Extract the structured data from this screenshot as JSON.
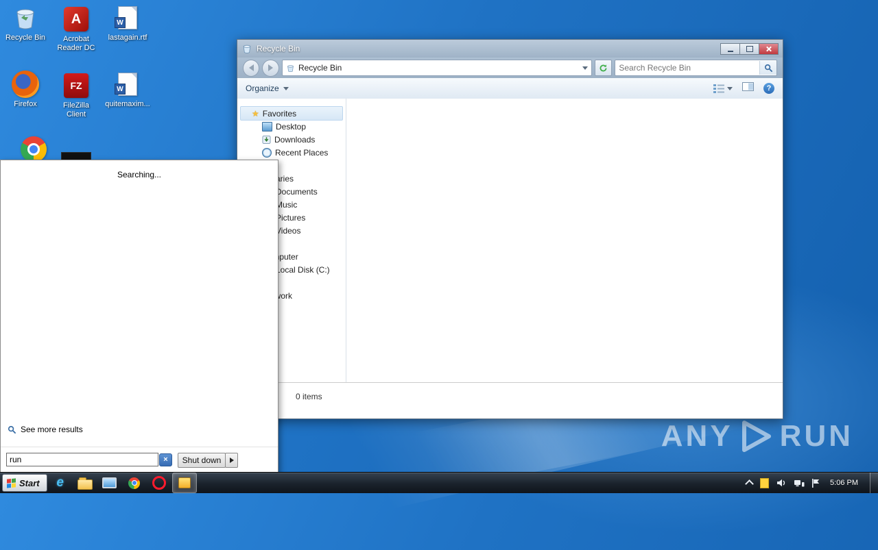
{
  "glyphs": {
    "word": "W",
    "filezilla": "FZ",
    "acrobat": "A",
    "ie": "e",
    "help": "?",
    "close_x": "×"
  },
  "desktop": {
    "icons": [
      {
        "label": "Recycle Bin"
      },
      {
        "label": "Acrobat Reader DC"
      },
      {
        "label": "lastagain.rtf"
      },
      {
        "label": "Firefox"
      },
      {
        "label": "FileZilla Client"
      },
      {
        "label": "quitemaxim..."
      }
    ],
    "watermark": {
      "left": "ANY",
      "right": "RUN"
    }
  },
  "explorer": {
    "title": "Recycle Bin",
    "address": "Recycle Bin",
    "search_placeholder": "Search Recycle Bin",
    "organize_label": "Organize",
    "status": "0 items",
    "nav": {
      "favorites_label": "Favorites",
      "favorites_items": [
        {
          "label": "Desktop"
        },
        {
          "label": "Downloads"
        },
        {
          "label": "Recent Places"
        }
      ],
      "libraries_label": "Libraries",
      "libraries_items": [
        {
          "label": "Documents"
        },
        {
          "label": "Music"
        },
        {
          "label": "Pictures"
        },
        {
          "label": "Videos"
        }
      ],
      "computer_label": "Computer",
      "computer_items": [
        {
          "label": "Local Disk (C:)"
        }
      ],
      "network_label": "Network"
    }
  },
  "start_menu": {
    "searching": "Searching...",
    "see_more": "See more results",
    "search_value": "run",
    "shutdown_label": "Shut down"
  },
  "taskbar": {
    "start_label": "Start",
    "clock": "5:06 PM"
  }
}
